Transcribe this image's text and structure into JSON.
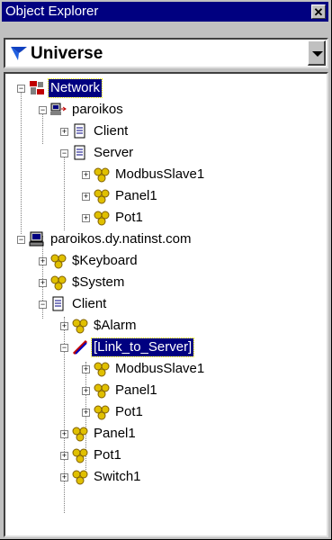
{
  "window": {
    "title": "Object Explorer",
    "close_glyph": "✕"
  },
  "combo": {
    "selected": "Universe",
    "icon": "universe-icon"
  },
  "tree": {
    "nodes": [
      {
        "label": "Network",
        "icon": "network-icon",
        "expander": "−",
        "selected": true
      },
      {
        "label": "paroikos",
        "icon": "computer-link-icon",
        "expander": "−"
      },
      {
        "label": "Client",
        "icon": "document-icon",
        "expander": "+"
      },
      {
        "label": "Server",
        "icon": "document-icon",
        "expander": "−"
      },
      {
        "label": "ModbusSlave1",
        "icon": "gear-cluster-icon",
        "expander": "+"
      },
      {
        "label": "Panel1",
        "icon": "gear-cluster-icon",
        "expander": "+"
      },
      {
        "label": "Pot1",
        "icon": "gear-cluster-icon",
        "expander": "+"
      },
      {
        "label": "paroikos.dy.natinst.com",
        "icon": "computer-icon",
        "expander": "−"
      },
      {
        "label": "$Keyboard",
        "icon": "gear-cluster-icon",
        "expander": "+"
      },
      {
        "label": "$System",
        "icon": "gear-cluster-icon",
        "expander": "+"
      },
      {
        "label": "Client",
        "icon": "document-icon",
        "expander": "−"
      },
      {
        "label": "$Alarm",
        "icon": "gear-cluster-icon",
        "expander": "+"
      },
      {
        "label": "[Link_to_Server]",
        "icon": "link-icon",
        "expander": "−",
        "focused": true
      },
      {
        "label": "ModbusSlave1",
        "icon": "gear-cluster-icon",
        "expander": "+"
      },
      {
        "label": "Panel1",
        "icon": "gear-cluster-icon",
        "expander": "+"
      },
      {
        "label": "Pot1",
        "icon": "gear-cluster-icon",
        "expander": "+"
      },
      {
        "label": "Panel1",
        "icon": "gear-cluster-icon",
        "expander": "+"
      },
      {
        "label": "Pot1",
        "icon": "gear-cluster-icon",
        "expander": "+"
      },
      {
        "label": "Switch1",
        "icon": "gear-cluster-icon",
        "expander": "+"
      }
    ]
  },
  "colors": {
    "selection": "#000080",
    "titlebar": "#000080",
    "face": "#c0c0c0"
  }
}
